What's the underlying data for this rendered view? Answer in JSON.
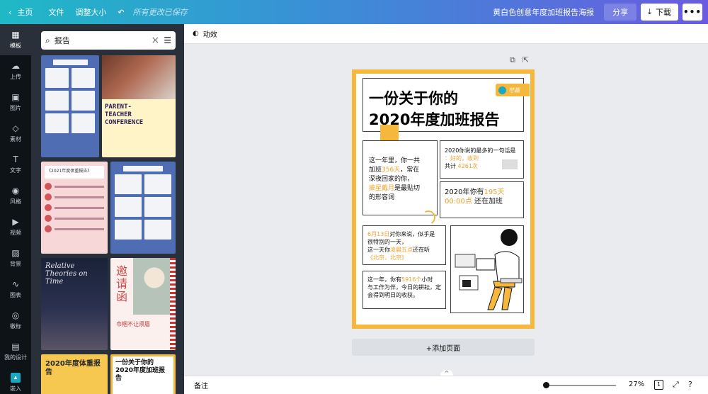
{
  "topbar": {
    "back_icon": "chevron-left-icon",
    "home": "主页",
    "file": "文件",
    "resize": "调整大小",
    "undo_icon": "undo-icon",
    "saved": "所有更改已保存",
    "title": "黄白色创意年度加班报告海报",
    "share": "分享",
    "download": "下载",
    "more_icon": "more-icon"
  },
  "rail": [
    {
      "label": "模板",
      "icon": "template-icon"
    },
    {
      "label": "上传",
      "icon": "upload-icon"
    },
    {
      "label": "图片",
      "icon": "image-icon"
    },
    {
      "label": "素材",
      "icon": "elements-icon"
    },
    {
      "label": "文字",
      "icon": "text-icon"
    },
    {
      "label": "风格",
      "icon": "palette-icon"
    },
    {
      "label": "视频",
      "icon": "video-icon"
    },
    {
      "label": "背景",
      "icon": "background-icon"
    },
    {
      "label": "图表",
      "icon": "chart-icon"
    },
    {
      "label": "徽标",
      "icon": "logo-icon"
    },
    {
      "label": "我的设计",
      "icon": "folder-icon"
    },
    {
      "label": "嵌入",
      "icon": "embed-icon"
    }
  ],
  "search": {
    "value": "报告",
    "icon": "search-icon",
    "clear_icon": "close-icon",
    "filter_icon": "filter-icon"
  },
  "thumbnails": {
    "parent_title": "PARENT-\nTEACHER\nCONFERENCE",
    "pink_title": "《2021年度体重报告》",
    "night_title": "Relative\nTheories on\nTime",
    "invite_title": "邀\n请\n函",
    "invite_sub": "巾帼不让须眉",
    "yellow_title": "2020年度体重报告",
    "mini_title": "一份关于你的\n2020年度加班报告"
  },
  "editor": {
    "animate": "动效",
    "animate_icon": "animate-icon",
    "copy_icon": "duplicate-icon",
    "add_icon": "add-page-icon",
    "add_page": "+添加页面",
    "notes": "备注",
    "zoom": "27%",
    "page_count": "1",
    "fullscreen_icon": "fullscreen-icon",
    "help_icon": "more-icon"
  },
  "poster": {
    "title_line1": "一份关于你的",
    "title_line2": "2020年度加班报告",
    "brand": "可画",
    "brand_mark": "Canva",
    "b1_line1": "这一年里，你一共",
    "b1_line2a": "加班",
    "b1_line2b": "356天",
    "b1_line2c": "，常在",
    "b1_line3": "深夜回家的你，",
    "b1_line4a": "披星戴月",
    "b1_line4b": "是最贴切",
    "b1_line5": "的形容词",
    "b2_line1": "2020你说的最多的一句话是",
    "b2_line2": "：好的，收到",
    "b2_line3a": "共计",
    "b2_line3b": "4261次",
    "b3_line1a": "2020年你有",
    "b3_line1b": "195天",
    "b3_line2a": "00:00点",
    "b3_line2b": "还在加班",
    "b4_line1a": "6月13日",
    "b4_line1b": "对你来说，似乎是",
    "b4_line2": "很特别的一天，",
    "b4_line3a": "这一天你",
    "b4_line3b": "凌晨五点",
    "b4_line3c": "还在听",
    "b4_line4": "《北京，北京》",
    "b5_line1a": "这一年，你有",
    "b5_line1b": "5916个",
    "b5_line1c": "小时",
    "b5_line2": "与工作为伴，今日的耕耘，定",
    "b5_line3": "会得到明日的收获。",
    "qr_label": "可画"
  }
}
